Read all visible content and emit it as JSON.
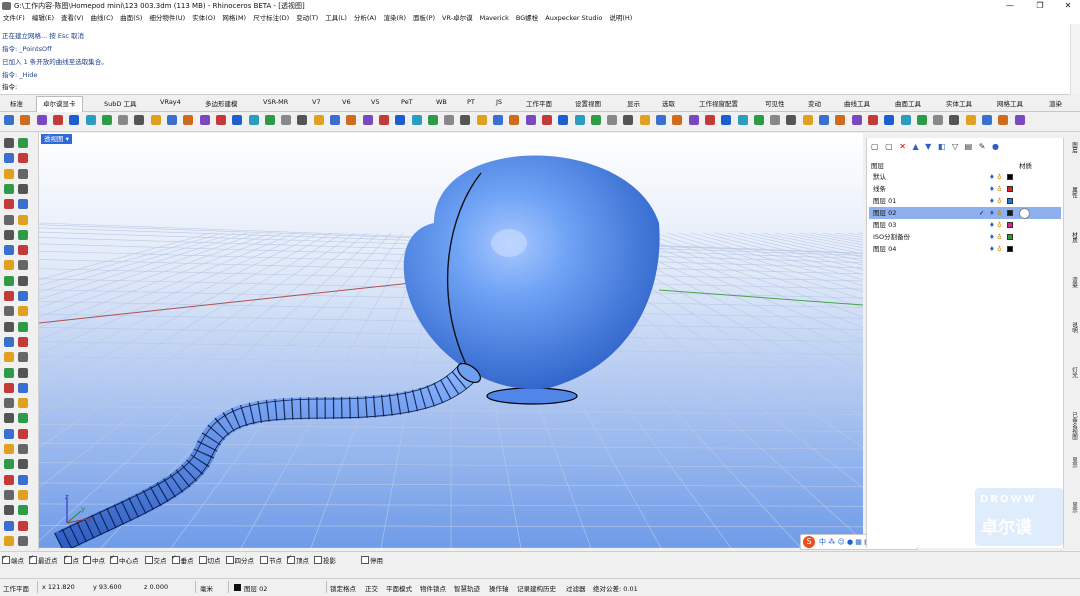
{
  "window": {
    "title": "G:\\工作内容-陈图\\Homepod mini\\123 003.3dm (113 MB) - Rhinoceros BETA - [透视图]",
    "controls": [
      "—",
      "❐",
      "✕"
    ]
  },
  "menu": [
    "文件(F)",
    "编辑(E)",
    "查看(V)",
    "曲线(C)",
    "曲面(S)",
    "细分物件(U)",
    "实体(O)",
    "网格(M)",
    "尺寸标注(D)",
    "变动(T)",
    "工具(L)",
    "分析(A)",
    "渲染(R)",
    "面板(P)",
    "VR-卓尔谟",
    "Maverick",
    "BG螺栓",
    "Auxpecker Studio",
    "说明(H)"
  ],
  "command": {
    "lines": [
      "正在建立网格... 按 Esc 取消",
      "指令: _PointsOff",
      "已加入 1 条开放的曲线至选取集合。",
      "指令: _Hide",
      "指令:"
    ]
  },
  "tabs": [
    "标准",
    "卓尔谟显卡",
    "SubD 工具",
    "VRay4",
    "多边形建模",
    "VSR-MR",
    "V7",
    "V6",
    "V5",
    "PeT",
    "WB",
    "PT",
    "JS",
    "工作平面",
    "设置视图",
    "显示",
    "选取",
    "工作视窗配置",
    "可见性",
    "变动",
    "曲线工具",
    "曲面工具",
    "实体工具",
    "网格工具",
    "渲染"
  ],
  "active_tab": "卓尔谟显卡",
  "viewport": {
    "label": "透视图 ▾"
  },
  "layers": {
    "header_name": "图层",
    "header_material": "材质",
    "rows": [
      {
        "name": "默认",
        "color": "#000000",
        "selected": false
      },
      {
        "name": "线条",
        "color": "#e02020",
        "selected": false
      },
      {
        "name": "图层 01",
        "color": "#1e78d6",
        "selected": false
      },
      {
        "name": "图层 02",
        "color": "#1a1a1a",
        "selected": true,
        "current": "✓"
      },
      {
        "name": "图层 03",
        "color": "#e0208f",
        "selected": false
      },
      {
        "name": "ISO分割备份",
        "color": "#2aa02a",
        "selected": false
      },
      {
        "name": "图层 04",
        "color": "#000000",
        "selected": false
      }
    ]
  },
  "right_panel_tabs": [
    "图层",
    "属性",
    "材质",
    "渲染",
    "说明",
    "灯光",
    "已命名视图",
    "显示",
    "显示"
  ],
  "osnap": [
    {
      "label": "端点",
      "checked": true
    },
    {
      "label": "最近点",
      "checked": true
    },
    {
      "label": "点",
      "checked": true
    },
    {
      "label": "中点",
      "checked": true
    },
    {
      "label": "中心点",
      "checked": true
    },
    {
      "label": "交点",
      "checked": false
    },
    {
      "label": "垂点",
      "checked": true
    },
    {
      "label": "切点",
      "checked": false
    },
    {
      "label": "四分点",
      "checked": false
    },
    {
      "label": "节点",
      "checked": false
    },
    {
      "label": "顶点",
      "checked": true
    },
    {
      "label": "投影",
      "checked": false
    },
    {
      "label": "停用",
      "checked": false
    }
  ],
  "status": {
    "cplane": "工作平面",
    "x": "x 121.820",
    "y": "y 93.600",
    "z": "z 0.000",
    "unit": "毫米",
    "layer": "图层 02",
    "toggles": [
      "锁定格点",
      "正交",
      "平面模式",
      "物件锁点",
      "智慧轨迹",
      "操作轴",
      "记录建构历史",
      "过滤器",
      "绝对公差: 0.01"
    ]
  },
  "watermark": {
    "line1": "DROWW",
    "line2": "卓尔谟"
  },
  "colors": {
    "accent": "#2e6ad9",
    "viewport_top": "#ffffff",
    "viewport_bottom": "#6f9be8",
    "object_blue": "#5b93ef"
  }
}
